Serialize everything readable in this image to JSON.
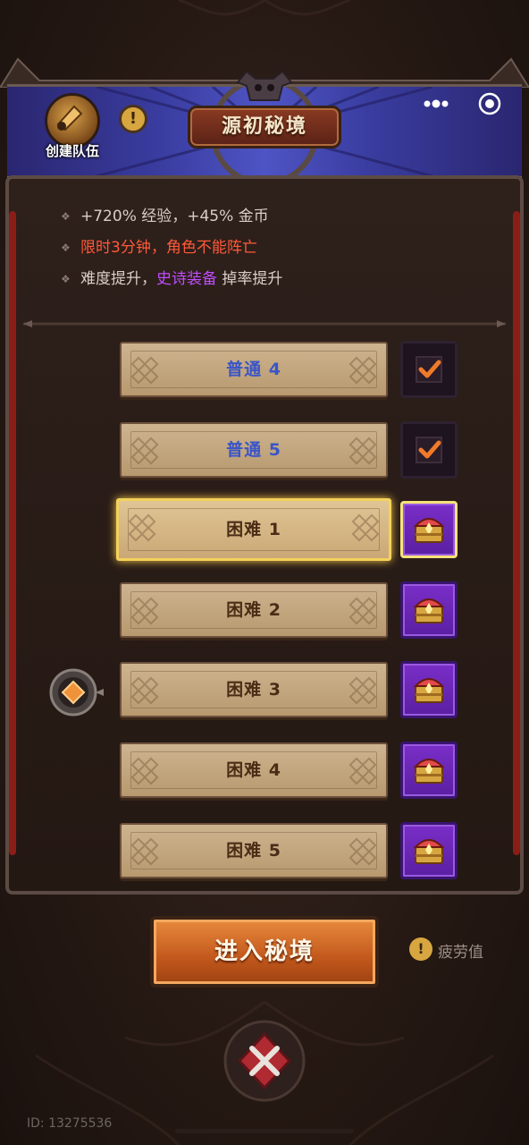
{
  "header": {
    "title": "源初秘境",
    "create_team_label": "创建队伍",
    "info_symbol": "!",
    "icons": [
      "horn-icon",
      "info-icon",
      "skull-icon",
      "more-icon",
      "target-icon"
    ]
  },
  "info": {
    "line1": "+720% 经验，+45% 金币",
    "line2": "限时3分钟，角色不能阵亡",
    "line3_prefix": "难度提升，",
    "line3_highlight": "史诗装备",
    "line3_suffix": " 掉率提升"
  },
  "levels": [
    {
      "label": "普通 4",
      "status": "completed"
    },
    {
      "label": "普通 5",
      "status": "completed"
    },
    {
      "label": "困难 1",
      "status": "reward",
      "selected": true
    },
    {
      "label": "困难 2",
      "status": "reward"
    },
    {
      "label": "困难 3",
      "status": "reward",
      "current": true
    },
    {
      "label": "困难 4",
      "status": "reward"
    },
    {
      "label": "困难 5",
      "status": "reward"
    }
  ],
  "footer": {
    "enter_label": "进入秘境",
    "fatigue_symbol": "!",
    "fatigue_label": "疲劳值",
    "user_id": "ID: 13275536"
  },
  "colors": {
    "accent_orange": "#c2581c",
    "header_blue": "#3a3da0",
    "reward_purple": "#7a2ec8",
    "selected_gold": "#f4d25c",
    "warning_red": "#ff5a3a",
    "epic_purple": "#c04cff"
  }
}
